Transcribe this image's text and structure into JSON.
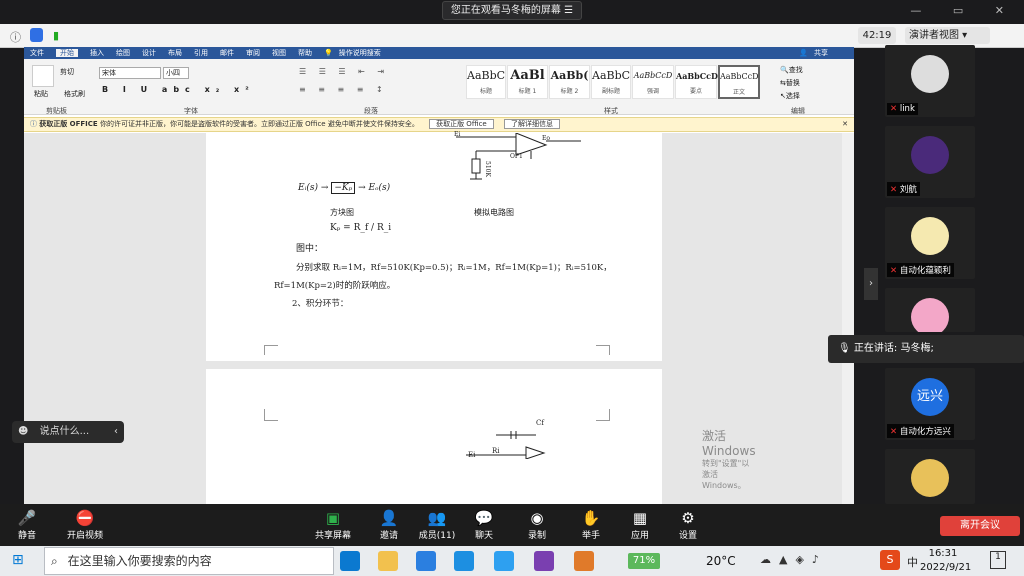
{
  "banner": "您正在观看马冬梅的屏幕",
  "timer": "42:19",
  "view_button": "演讲者视图",
  "word": {
    "tabs": [
      "文件",
      "开始",
      "插入",
      "绘图",
      "设计",
      "布局",
      "引用",
      "邮件",
      "审阅",
      "视图",
      "帮助",
      "操作说明搜索"
    ],
    "share": "共享",
    "clipboard": {
      "paste": "粘贴",
      "cut": "剪切",
      "format": "格式刷",
      "group": "剪贴板"
    },
    "font_group": "字体",
    "para_group": "段落",
    "style_group": "样式",
    "edit_group": "编辑",
    "font_name": "宋体",
    "font_size": "小四",
    "styles": [
      {
        "sample": "AaBbC",
        "name": "标题"
      },
      {
        "sample": "AaBl",
        "name": "标题 1"
      },
      {
        "sample": "AaBb(",
        "name": "标题 2"
      },
      {
        "sample": "AaBbC",
        "name": "副标题"
      },
      {
        "sample": "AaBbCcD",
        "name": "强调"
      },
      {
        "sample": "AaBbCcD",
        "name": "要点"
      },
      {
        "sample": "AaBbCcD",
        "name": "正文"
      }
    ],
    "edit": {
      "find": "查找",
      "replace": "替换",
      "select": "选择"
    },
    "warning": {
      "title": "获取正版 OFFICE",
      "text": "你的许可证并非正版，你可能是盗版软件的受害者。立即通过正版 Office 避免中断并使文件保持安全。",
      "btn1": "获取正版 Office",
      "btn2": "了解详细信息"
    },
    "doc": {
      "circuit_labels": {
        "ei": "Ei",
        "eo": "Eo",
        "op": "OP1",
        "r": "510K"
      },
      "block_eq_left": "Eᵢ(s) →",
      "block_box": "−Kₚ",
      "block_eq_right": "→ Eₒ(s)",
      "caption_block": "方块图",
      "caption_circuit": "模拟电路图",
      "legend": "图中：",
      "kp_formula": "Kₚ = R_f / R_i",
      "line1": "分别求取 Rᵢ=1M，Rf=510K(Kp=0.5)；Rᵢ=1M，Rf=1M(Kp=1)；Rᵢ=510K，",
      "line2": "Rf=1M(Kp=2)时的阶跃响应。",
      "section": "2、积分环节：",
      "cf": "Cf",
      "ri": "Ri",
      "ei2": "Ei"
    },
    "watermark": "激活 Windows",
    "watermark_sub": "转到\"设置\"以激活 Windows。"
  },
  "participants": [
    {
      "name": "link"
    },
    {
      "name": "刘航"
    },
    {
      "name": "自动化蕴颖利"
    },
    {
      "name": ""
    },
    {
      "name": "自动化方远兴",
      "avatar_text": "远兴"
    },
    {
      "name": ""
    }
  ],
  "chat_placeholder": "说点什么...",
  "speaking": "正在讲话: 马冬梅;",
  "toolbar": {
    "mute": "静音",
    "video": "开启视频",
    "share": "共享屏幕",
    "invite": "邀请",
    "members": "成员(11)",
    "chat": "聊天",
    "record": "录制",
    "raise": "举手",
    "apps": "应用",
    "settings": "设置",
    "leave": "离开会议"
  },
  "taskbar": {
    "search": "在这里输入你要搜索的内容",
    "battery": "71%",
    "temp": "20°C",
    "ime": "中",
    "time": "16:31",
    "date": "2022/9/21"
  },
  "colors": {
    "word_blue": "#2b579a",
    "zoom_dark": "#1c1c1c",
    "warn_bg": "#fff4ce",
    "leave_red": "#e0413a"
  }
}
